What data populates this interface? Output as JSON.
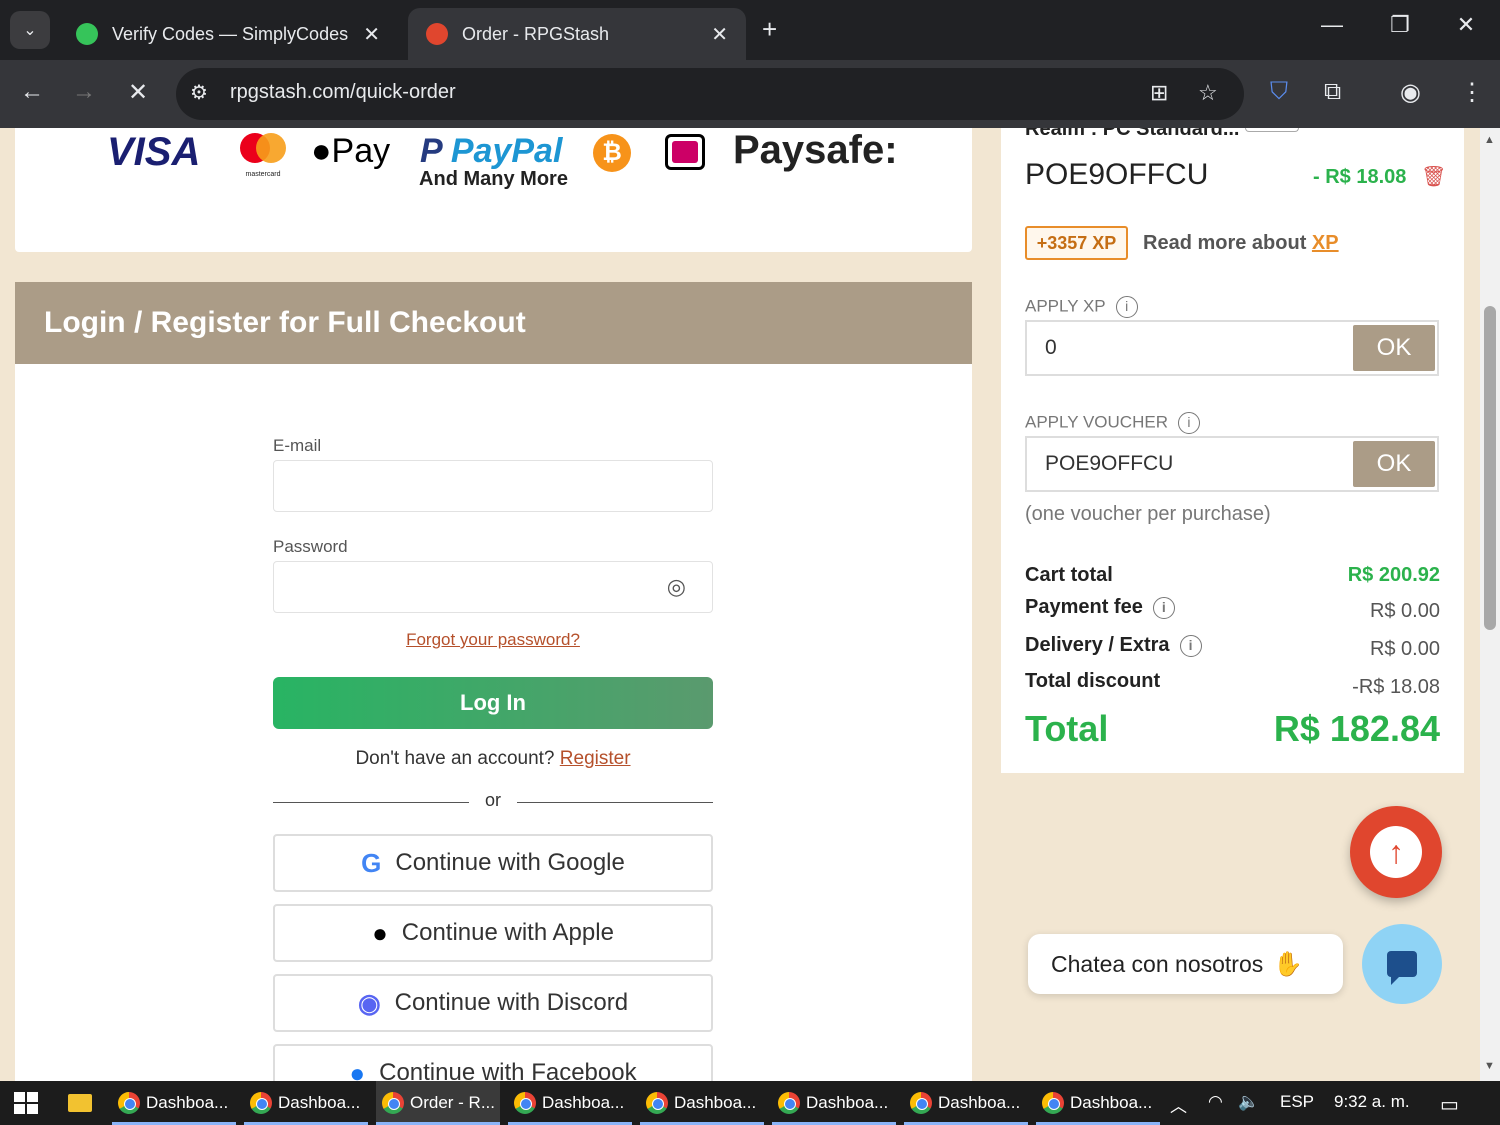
{
  "browser": {
    "tabs": [
      {
        "title": "Verify Codes — SimplyCodes",
        "active": false
      },
      {
        "title": "Order - RPGStash",
        "active": true
      }
    ],
    "url": "rpgstash.com/quick-order"
  },
  "payments": {
    "logos": [
      "VISA",
      "Pay",
      "PayPal",
      "Paysafe:"
    ],
    "mastercard_caption": "mastercard",
    "more_label": "And Many More"
  },
  "login": {
    "title": "Login / Register for Full Checkout",
    "email_label": "E-mail",
    "password_label": "Password",
    "forgot_label": "Forgot your password?",
    "login_button": "Log In",
    "no_account_text": "Don't have an account?",
    "register_link": "Register",
    "or_text": "or",
    "social": {
      "google": "Continue with Google",
      "apple": "Continue with Apple",
      "discord": "Continue with Discord",
      "facebook": "Continue with Facebook"
    }
  },
  "summary": {
    "realm": "Realm : PC Standard...",
    "voucher_code": "POE9OFFCU",
    "voucher_discount": "- R$ 18.08",
    "xp_badge": "+3357 XP",
    "xp_read_prefix": "Read more about ",
    "xp_read_link": "XP",
    "apply_xp_label": "APPLY XP",
    "apply_xp_value": "0",
    "ok_label": "OK",
    "apply_voucher_label": "APPLY VOUCHER",
    "apply_voucher_value": "POE9OFFCU",
    "one_voucher_note": "(one voucher per purchase)",
    "cart_total_label": "Cart total",
    "cart_total_value": "R$ 200.92",
    "payment_fee_label": "Payment fee",
    "payment_fee_value": "R$ 0.00",
    "delivery_label": "Delivery / Extra",
    "delivery_value": "R$ 0.00",
    "total_discount_label": "Total discount",
    "total_discount_value": "-R$ 18.08",
    "total_label": "Total",
    "total_value": "R$ 182.84"
  },
  "chat": {
    "bubble_text": "Chatea con nosotros"
  },
  "taskbar": {
    "items": [
      "Dashboa...",
      "Dashboa...",
      "Order - R...",
      "Dashboa...",
      "Dashboa...",
      "Dashboa...",
      "Dashboa...",
      "Dashboa..."
    ],
    "language": "ESP",
    "time": "9:32 a. m."
  },
  "colors": {
    "accent_tan": "#ab9c87",
    "green": "#2bb24c",
    "link_orange": "#b5502b",
    "page_bg": "#f2e6d2"
  }
}
